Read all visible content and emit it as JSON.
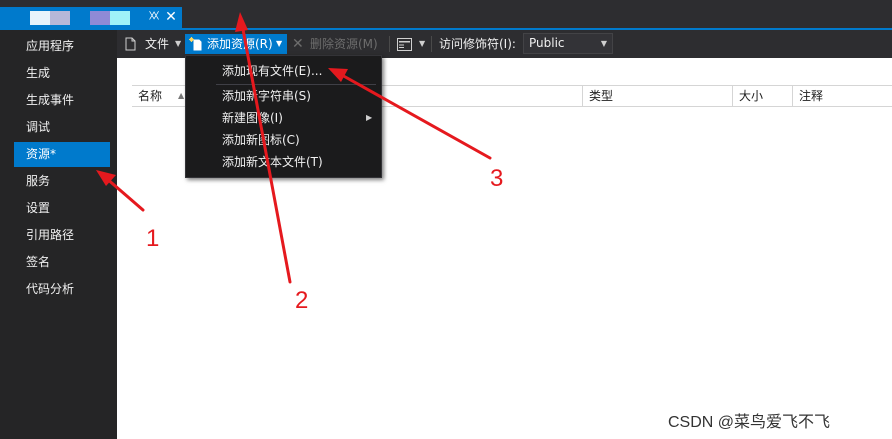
{
  "tab": {
    "pin_glyph": "⯵",
    "close_glyph": "✕",
    "blocks": [
      "#e8f4fb",
      "#b7b7d8",
      "#8f8ad6",
      "#9ff3f8"
    ]
  },
  "nav": {
    "items": [
      {
        "label": "应用程序"
      },
      {
        "label": "生成"
      },
      {
        "label": "生成事件"
      },
      {
        "label": "调试"
      },
      {
        "label": "资源*"
      },
      {
        "label": "服务"
      },
      {
        "label": "设置"
      },
      {
        "label": "引用路径"
      },
      {
        "label": "签名"
      },
      {
        "label": "代码分析"
      }
    ],
    "active_index": 4
  },
  "toolbar": {
    "file_label": "文件",
    "add_resource_label": "添加资源(R)",
    "delete_resource_label": "删除资源(M)",
    "access_label": "访问修饰符(I):",
    "access_value": "Public"
  },
  "grid": {
    "columns": {
      "name": "名称",
      "type": "类型",
      "size": "大小",
      "comment": "注释"
    }
  },
  "menu": {
    "items": [
      {
        "label": "添加现有文件(E)..."
      },
      {
        "label": "添加新字符串(S)"
      },
      {
        "label": "新建图像(I)"
      },
      {
        "label": "添加新图标(C)"
      },
      {
        "label": "添加新文本文件(T)"
      }
    ]
  },
  "annotations": {
    "n1": "1",
    "n2": "2",
    "n3": "3",
    "color": "#e5191e"
  },
  "watermark": "CSDN @菜鸟爱飞不飞",
  "colors": {
    "accent": "#007acc",
    "bg": "#2d2d30",
    "nav_bg": "#252526"
  }
}
